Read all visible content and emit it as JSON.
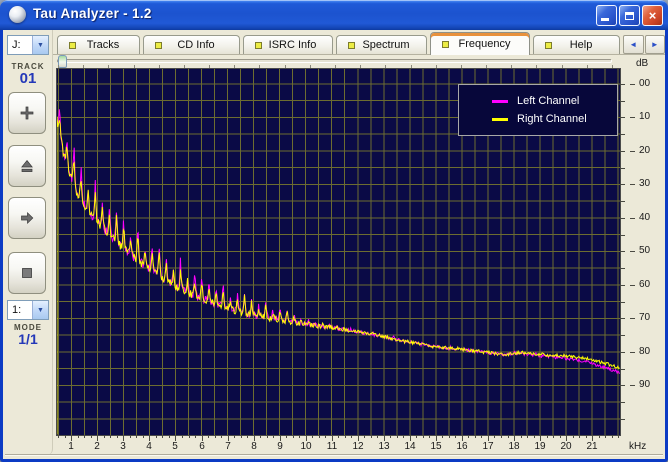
{
  "window": {
    "title": "Tau Analyzer - 1.2",
    "controls": {
      "minimize": "minimize",
      "maximize": "maximize",
      "close": "close"
    }
  },
  "sidebar": {
    "drive_select": {
      "value": "J:"
    },
    "track_label": "TRACK",
    "track_number": "01",
    "buttons": [
      {
        "name": "add"
      },
      {
        "name": "eject"
      },
      {
        "name": "next"
      },
      {
        "name": "stop"
      }
    ],
    "mode_select": {
      "value": "1:"
    },
    "mode_label": "MODE",
    "mode_value": "1/1"
  },
  "tabs": [
    {
      "label": "Tracks",
      "active": false
    },
    {
      "label": "CD Info",
      "active": false
    },
    {
      "label": "ISRC Info",
      "active": false
    },
    {
      "label": "Spectrum",
      "active": false
    },
    {
      "label": "Frequency",
      "active": true
    },
    {
      "label": "Help",
      "active": false
    }
  ],
  "tab_scroll": {
    "left_arrow": "◄",
    "right_arrow": "►"
  },
  "slider": {
    "thumb_position": "left",
    "tick_count": 23
  },
  "chart_data": {
    "type": "line",
    "title": "Frequency spectrum",
    "xlabel": "kHz",
    "ylabel": "dB",
    "x_view": [
      0.45,
      22.07
    ],
    "y_view": [
      -4.48,
      104.82
    ],
    "y_inverted": true,
    "bg": "#0a0a46",
    "grid": {
      "on": true,
      "x_step": 0.5,
      "y_step": 5,
      "color": "#6c6c30"
    },
    "x_tick_step": 0.25,
    "x_label_values": [
      1,
      2,
      3,
      4,
      5,
      6,
      7,
      8,
      9,
      10,
      11,
      12,
      13,
      14,
      15,
      16,
      17,
      18,
      19,
      20,
      21
    ],
    "x_tick_labels": [
      "1",
      "2",
      "3",
      "4",
      "5",
      "6",
      "7",
      "8",
      "9",
      "10",
      "11",
      "12",
      "13",
      "14",
      "15",
      "16",
      "17",
      "18",
      "19",
      "20",
      "21"
    ],
    "y_tick_step": 5,
    "y_label_values": [
      0,
      10,
      20,
      30,
      40,
      50,
      60,
      70,
      80,
      90
    ],
    "y_tick_labels": [
      "00",
      "10",
      "20",
      "30",
      "40",
      "50",
      "60",
      "70",
      "80",
      "90"
    ],
    "legend": {
      "position": "top-right",
      "items": [
        {
          "label": "Left Channel",
          "color": "#ff00ff"
        },
        {
          "label": "Right Channel",
          "color": "#ffff00"
        }
      ]
    },
    "envelope_dB": [
      [
        0.45,
        10
      ],
      [
        0.5,
        13
      ],
      [
        0.6,
        17
      ],
      [
        0.8,
        24
      ],
      [
        1.0,
        28
      ],
      [
        1.2,
        32
      ],
      [
        1.5,
        36
      ],
      [
        1.8,
        39.5
      ],
      [
        2.1,
        42
      ],
      [
        2.5,
        45.5
      ],
      [
        3.0,
        49
      ],
      [
        3.5,
        52.5
      ],
      [
        4.0,
        55
      ],
      [
        4.5,
        58
      ],
      [
        5.0,
        60.5
      ],
      [
        5.5,
        62.5
      ],
      [
        6.0,
        64
      ],
      [
        6.5,
        65.5
      ],
      [
        7.0,
        67
      ],
      [
        7.5,
        68.2
      ],
      [
        8.0,
        69
      ],
      [
        9.0,
        70.5
      ],
      [
        10.0,
        71.8
      ],
      [
        11.0,
        72.8
      ],
      [
        12.0,
        74
      ],
      [
        13.0,
        75.5
      ],
      [
        14.0,
        77.2
      ],
      [
        15.0,
        78.5
      ],
      [
        16.0,
        79.3
      ],
      [
        17.0,
        80.2
      ],
      [
        17.6,
        80.9
      ],
      [
        18.2,
        80.3
      ],
      [
        19.0,
        80.8
      ],
      [
        20.0,
        81.3
      ],
      [
        20.8,
        82
      ],
      [
        21.5,
        83.5
      ],
      [
        22.07,
        84.8
      ]
    ],
    "peaks": {
      "phase": 0.28,
      "interval": 0.273,
      "width": 0.085,
      "amplitude": [
        [
          0.5,
          11
        ],
        [
          1.5,
          10
        ],
        [
          2.5,
          9.5
        ],
        [
          3.5,
          9
        ],
        [
          4.5,
          8
        ],
        [
          5.5,
          7
        ],
        [
          6.5,
          6
        ],
        [
          7.5,
          5.5
        ],
        [
          8.5,
          4
        ],
        [
          9.3,
          2.8
        ],
        [
          10,
          1.2
        ],
        [
          11,
          0.6
        ],
        [
          12,
          0.35
        ],
        [
          22.07,
          0.25
        ]
      ]
    },
    "noise_dB": [
      [
        0.45,
        1.4
      ],
      [
        6,
        1.2
      ],
      [
        9,
        0.8
      ],
      [
        12,
        0.5
      ],
      [
        22.07,
        0.45
      ]
    ],
    "start_spike": {
      "f": 0.45,
      "dB": 106
    },
    "sample_step_kHz": 0.03,
    "series": [
      {
        "name": "Left Channel",
        "color": "#ff00ff",
        "seed": 11,
        "peak_scale": 1.05,
        "hf_bias": 0.35
      },
      {
        "name": "Right Channel",
        "color": "#ffff00",
        "seed": 5,
        "peak_scale": 0.82,
        "hf_bias": 0
      }
    ]
  }
}
